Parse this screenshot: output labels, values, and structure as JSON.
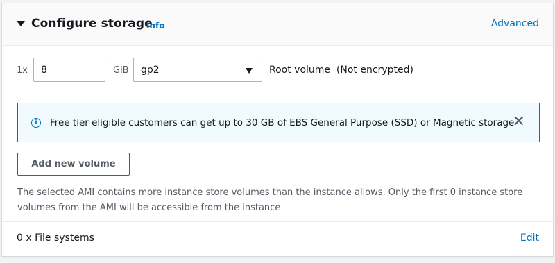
{
  "header": {
    "title": "Configure storage",
    "info_link": "Info",
    "advanced_link": "Advanced",
    "collapse_icon": "caret-down-icon"
  },
  "volume": {
    "quantity_label": "1x",
    "size_value": "8",
    "size_unit": "GiB",
    "volume_type": "gp2",
    "description": "Root volume  (Not encrypted)"
  },
  "alert": {
    "icon": "info-icon",
    "text": "Free tier eligible customers can get up to 30 GB of EBS General Purpose (SSD) or Magnetic storage",
    "dismiss_icon": "close-icon",
    "info_glyph": "i",
    "close_glyph": "✕"
  },
  "add_volume_button": "Add new volume",
  "note": "The selected AMI contains more instance store volumes than the instance allows. Only the first 0 instance store volumes from the AMI will be accessible from the instance",
  "file_systems": {
    "label": "0 x File systems",
    "edit_link": "Edit"
  },
  "colors": {
    "link": "#0073bb",
    "alert_background": "#f1faff",
    "text": "#16191f",
    "secondary_text": "#545b64"
  }
}
